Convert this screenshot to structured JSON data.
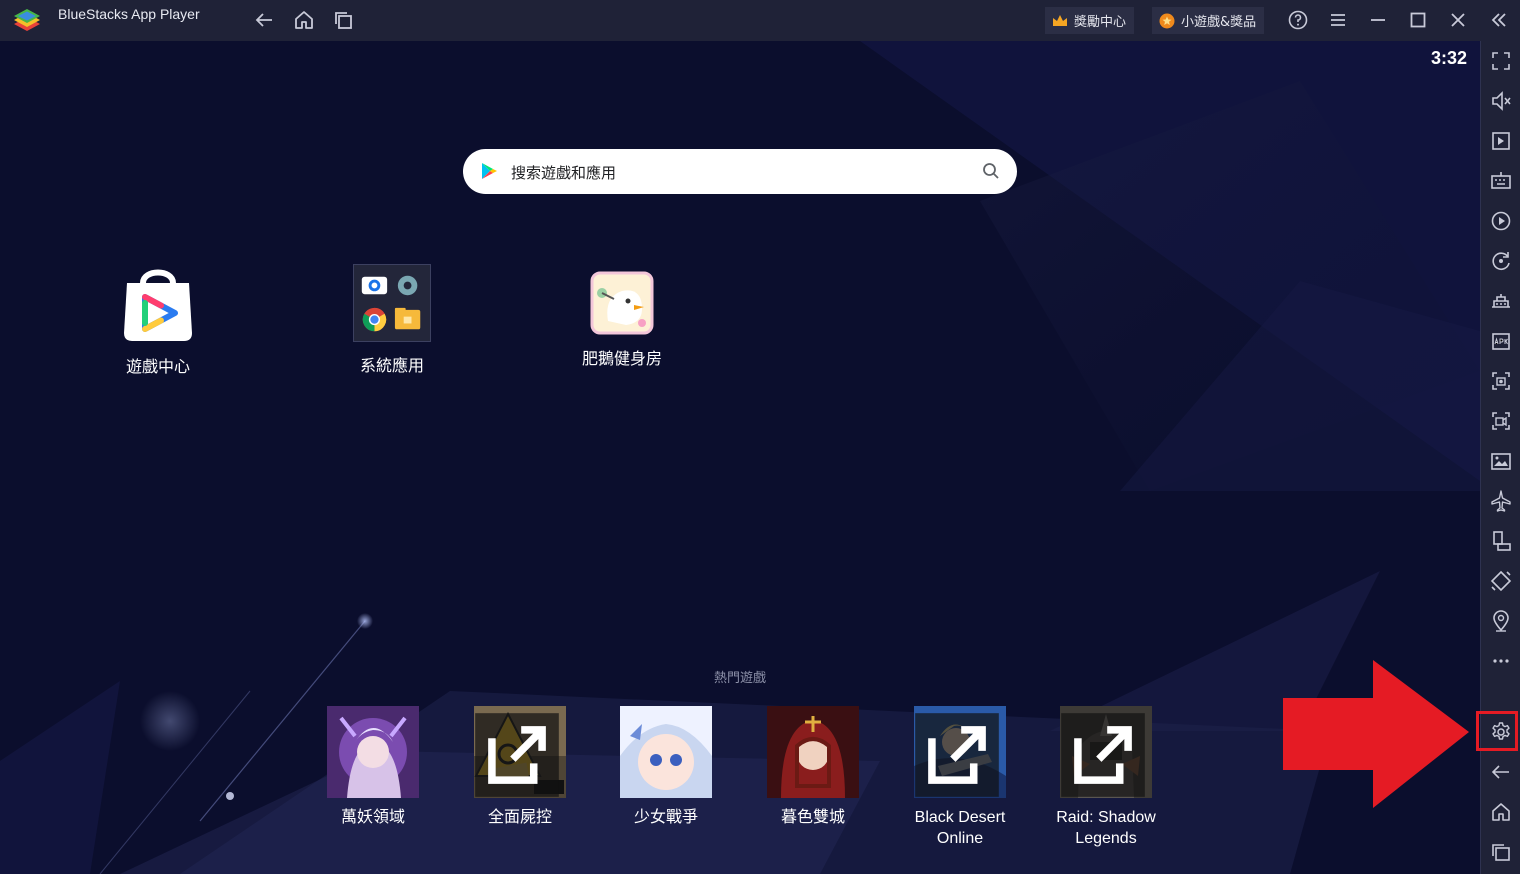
{
  "window": {
    "title": "BlueStacks App Player",
    "rewards_label": "獎勵中心",
    "minigames_label": "小遊戲&獎品"
  },
  "status": {
    "time": "3:32"
  },
  "search": {
    "placeholder": "搜索遊戲和應用"
  },
  "home_apps": [
    {
      "label": "遊戲中心",
      "icon": "game-center-icon"
    },
    {
      "label": "系統應用",
      "icon": "system-apps-folder-icon"
    },
    {
      "label": "肥鵝健身房",
      "icon": "goose-gym-icon"
    }
  ],
  "hot_games": {
    "title": "熱門遊戲",
    "items": [
      {
        "line1": "萬妖領域",
        "line2": "",
        "external": false
      },
      {
        "line1": "全面屍控",
        "line2": "",
        "external": true
      },
      {
        "line1": "少女戰爭",
        "line2": "",
        "external": false
      },
      {
        "line1": "暮色雙城",
        "line2": "",
        "external": false
      },
      {
        "line1": "Black Desert",
        "line2": "Online",
        "external": true
      },
      {
        "line1": "Raid: Shadow",
        "line2": "Legends",
        "external": true
      }
    ]
  },
  "toolbar": [
    "fullscreen-icon",
    "volume-icon",
    "media-manager-icon",
    "keyboard-icon",
    "macro-play-icon",
    "sync-icon",
    "instance-icon",
    "apk-install-icon",
    "screenshot-icon",
    "record-icon",
    "media-folder-icon",
    "airplane-icon",
    "rotate-icon",
    "shake-icon",
    "location-icon",
    "more-icon",
    "settings-icon",
    "back-icon",
    "home-icon",
    "recent-apps-icon"
  ],
  "highlight": {
    "target": "settings-icon",
    "color": "#e51b24"
  },
  "colors": {
    "titlebar": "#1f2237",
    "background": "#0b0e2d",
    "accent": "#e51b24"
  }
}
